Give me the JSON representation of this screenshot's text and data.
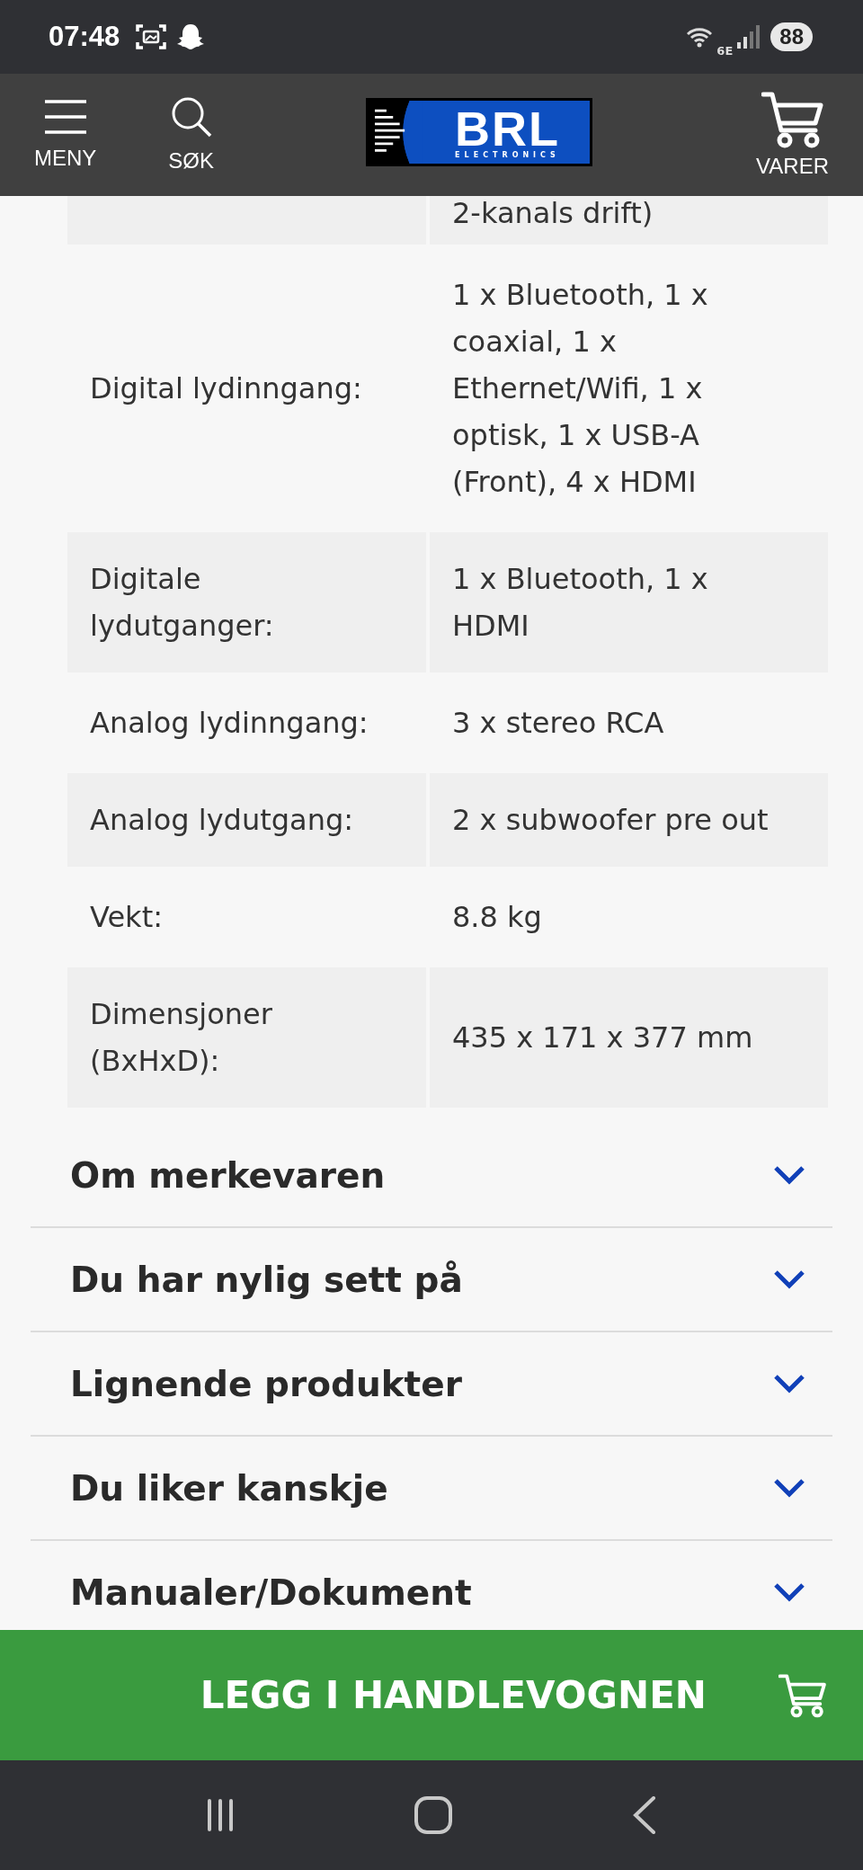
{
  "status_bar": {
    "time": "07:48",
    "network": "6E",
    "battery": "88"
  },
  "header": {
    "menu_label": "MENY",
    "search_label": "SØK",
    "logo": {
      "name": "BRL",
      "tagline": "ELECTRONICS"
    },
    "cart_label": "VARER"
  },
  "specs": [
    {
      "value": "2-kanals drift)"
    },
    {
      "key": "Digital lydinngang:",
      "value": "1 x Bluetooth, 1 x coaxial, 1 x Ethernet/Wifi, 1 x optisk, 1 x USB-A (Front), 4 x HDMI"
    },
    {
      "key": "Digitale lydutganger:",
      "value": "1 x Bluetooth, 1 x HDMI"
    },
    {
      "key": "Analog lydinngang:",
      "value": "3 x stereo RCA"
    },
    {
      "key": "Analog lydutgang:",
      "value": "2 x subwoofer pre out"
    },
    {
      "key": "Vekt:",
      "value": "8.8 kg"
    },
    {
      "key": "Dimensjoner (BxHxD):",
      "value": "435 x 171 x 377 mm"
    }
  ],
  "sections": [
    {
      "title": "Om merkevaren",
      "expanded": false
    },
    {
      "title": "Du har nylig sett på",
      "expanded": false
    },
    {
      "title": "Lignende produkter",
      "expanded": false
    },
    {
      "title": "Du liker kanskje",
      "expanded": false
    },
    {
      "title": "Manualer/Dokument",
      "expanded": false
    }
  ],
  "add_to_cart": {
    "label": "LEGG I HANDLEVOGNEN"
  }
}
